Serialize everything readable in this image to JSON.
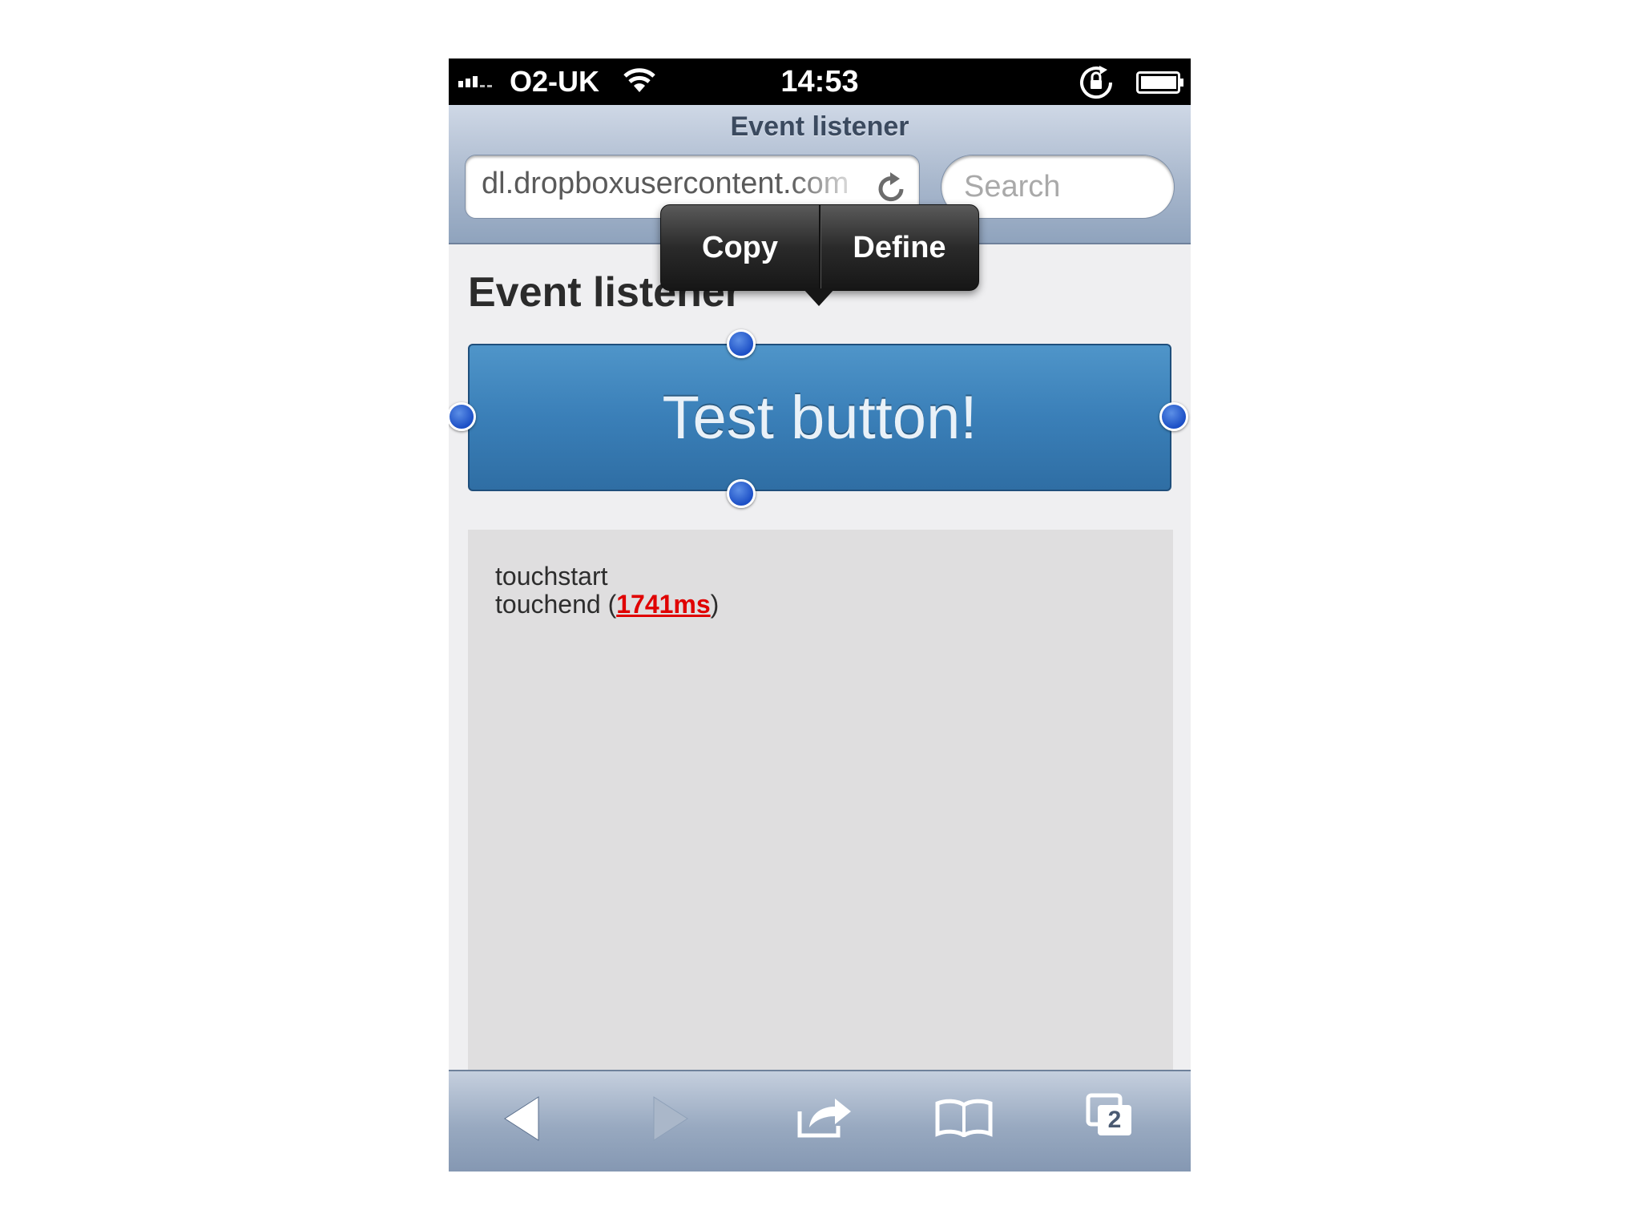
{
  "status_bar": {
    "carrier": "O2-UK",
    "time": "14:53"
  },
  "safari": {
    "page_title": "Event listener",
    "url": "dl.dropboxusercontent.com",
    "search_placeholder": "Search",
    "tab_count": "2"
  },
  "callout_menu": {
    "copy_label": "Copy",
    "define_label": "Define"
  },
  "page": {
    "heading": "Event listener",
    "button_label": "Test button!",
    "log": {
      "line1": "touchstart",
      "line2_prefix": "touchend (",
      "line2_ms": "1741ms",
      "line2_suffix": ")"
    }
  },
  "colors": {
    "button_blue": "#3a7fb8",
    "highlight_red": "#e00000",
    "toolbar_blue": "#98a9c0"
  },
  "icons": [
    "signal-icon",
    "wifi-icon",
    "rotation-lock-icon",
    "battery-icon",
    "reload-icon",
    "back-icon",
    "forward-icon",
    "share-icon",
    "bookmarks-icon",
    "tabs-icon"
  ]
}
